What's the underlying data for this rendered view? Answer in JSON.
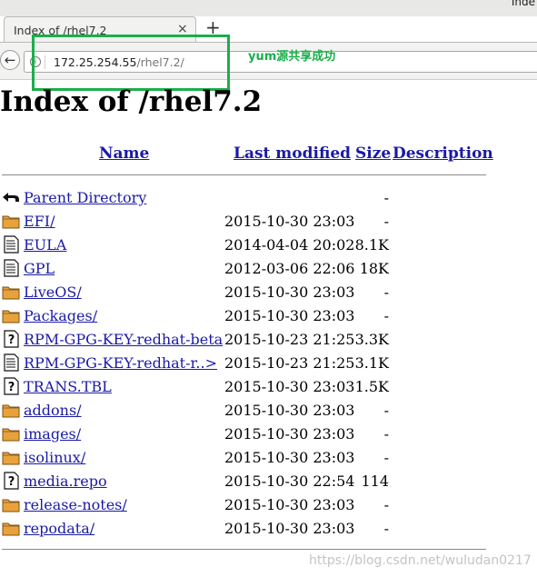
{
  "browser": {
    "window_title": "Inde",
    "tab_title": "Index of /rhel7.2",
    "tab_close": "×",
    "new_tab": "+",
    "back": "←",
    "info": "i",
    "url_host": "172.25.254.55",
    "url_path": "/rhel7.2/",
    "annotation": "yum源共享成功"
  },
  "page": {
    "heading": "Index of /rhel7.2",
    "columns": {
      "name": "Name",
      "last_modified": "Last modified",
      "size": "Size",
      "description": "Description"
    },
    "entries": [
      {
        "icon": "back-icon",
        "name": "Parent Directory",
        "modified": "",
        "size": "-"
      },
      {
        "icon": "folder-icon",
        "name": "EFI/",
        "modified": "2015-10-30 23:03",
        "size": "-"
      },
      {
        "icon": "text-file-icon",
        "name": "EULA",
        "modified": "2014-04-04 20:02",
        "size": "8.1K"
      },
      {
        "icon": "text-file-icon",
        "name": "GPL",
        "modified": "2012-03-06 22:06",
        "size": "18K"
      },
      {
        "icon": "folder-icon",
        "name": "LiveOS/",
        "modified": "2015-10-30 23:03",
        "size": "-"
      },
      {
        "icon": "folder-icon",
        "name": "Packages/",
        "modified": "2015-10-30 23:03",
        "size": "-"
      },
      {
        "icon": "unknown-file-icon",
        "name": "RPM-GPG-KEY-redhat-beta",
        "modified": "2015-10-23 21:25",
        "size": "3.3K"
      },
      {
        "icon": "text-file-icon",
        "name": "RPM-GPG-KEY-redhat-r..>",
        "modified": "2015-10-23 21:25",
        "size": "3.1K"
      },
      {
        "icon": "unknown-file-icon",
        "name": "TRANS.TBL",
        "modified": "2015-10-30 23:03",
        "size": "1.5K"
      },
      {
        "icon": "folder-icon",
        "name": "addons/",
        "modified": "2015-10-30 23:03",
        "size": "-"
      },
      {
        "icon": "folder-icon",
        "name": "images/",
        "modified": "2015-10-30 23:03",
        "size": "-"
      },
      {
        "icon": "folder-icon",
        "name": "isolinux/",
        "modified": "2015-10-30 23:03",
        "size": "-"
      },
      {
        "icon": "unknown-file-icon",
        "name": "media.repo",
        "modified": "2015-10-30 22:54",
        "size": "114"
      },
      {
        "icon": "folder-icon",
        "name": "release-notes/",
        "modified": "2015-10-30 23:03",
        "size": "-"
      },
      {
        "icon": "folder-icon",
        "name": "repodata/",
        "modified": "2015-10-30 23:03",
        "size": "-"
      }
    ]
  },
  "watermark": "https://blog.csdn.net/wuludan0217"
}
